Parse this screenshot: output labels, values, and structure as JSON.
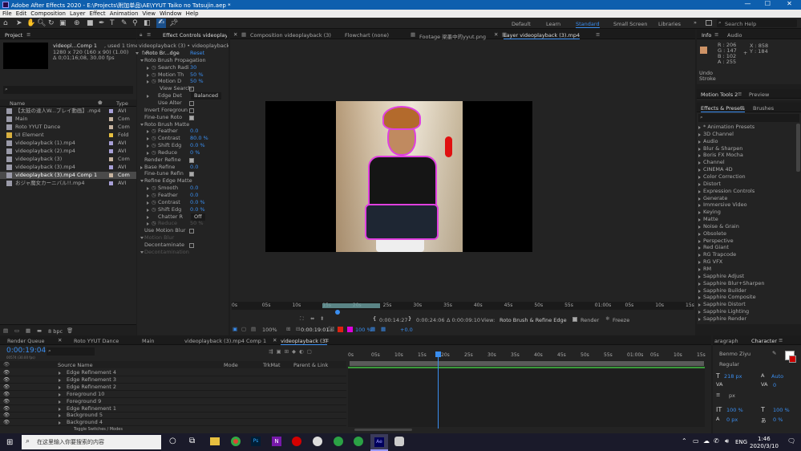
{
  "titlebar": {
    "title": "Adobe After Effects 2020 - E:\\Projects\\附加单品\\AE\\YYUT Taiko no Tatsujin.aep *"
  },
  "menu": [
    "File",
    "Edit",
    "Composition",
    "Layer",
    "Effect",
    "Animation",
    "View",
    "Window",
    "Help"
  ],
  "workspaces": [
    "Default",
    "Learn",
    "Standard",
    "Small Screen",
    "Libraries"
  ],
  "search_help": "Search Help",
  "project": {
    "tab": "Project",
    "item_name": "videopl...Comp 1",
    "used": ", used 1 time",
    "info1": "1280 x 720 (160 x 90) (1.00)",
    "info2": "Δ 0;01;16;08, 30.00 fps",
    "col_name": "Name",
    "col_type": "Type",
    "bpc": "8 bpc",
    "items": [
      {
        "name": "【太鼓の達人W...プレイ動画】.mp4",
        "type": "AVI",
        "color": "#a8a0d8"
      },
      {
        "name": "Main",
        "type": "Com",
        "color": "#c8b4a0"
      },
      {
        "name": "Roto YYUT Dance",
        "type": "Com",
        "color": "#c8b4a0"
      },
      {
        "name": "UI Element",
        "type": "Fold",
        "color": "#e8c040"
      },
      {
        "name": "videoplayback (1).mp4",
        "type": "AVI",
        "color": "#a8a0d8"
      },
      {
        "name": "videoplayback (2).mp4",
        "type": "AVI",
        "color": "#a8a0d8"
      },
      {
        "name": "videoplayback (3)",
        "type": "Com",
        "color": "#c8b4a0"
      },
      {
        "name": "videoplayback (3).mp4",
        "type": "AVI",
        "color": "#a8a0d8"
      },
      {
        "name": "videoplayback (3).mp4 Comp 1",
        "type": "Com",
        "color": "#c8b4a0"
      },
      {
        "name": "おジャ魔女カーニバル!!.mp4",
        "type": "AVI",
        "color": "#a8a0d8"
      }
    ]
  },
  "effect_controls": {
    "tab": "Effect Controls videoplayback",
    "path": "videoplayback (3) • videoplayback (3).mp",
    "rows": [
      {
        "label": "Roto Br...dge",
        "value": "Reset",
        "indent": 0
      },
      {
        "label": "Roto Brush Propagation",
        "value": "",
        "indent": 1
      },
      {
        "label": "Search Radi",
        "value": "30",
        "indent": 2
      },
      {
        "label": "Motion Th",
        "value": "50 %",
        "indent": 2
      },
      {
        "label": "Motion D",
        "value": "50 %",
        "indent": 2
      },
      {
        "label": "View Search",
        "value": "☐",
        "indent": 3
      },
      {
        "label": "Edge Det",
        "value": "Balanced",
        "indent": 2
      },
      {
        "label": "Use Alter",
        "value": "☐",
        "indent": 2
      },
      {
        "label": "Invert Foregroun",
        "value": "☐",
        "indent": 1
      },
      {
        "label": "Fine-tune Roto",
        "value": "☑",
        "indent": 1
      },
      {
        "label": "Roto Brush Matte",
        "value": "",
        "indent": 1
      },
      {
        "label": "Feather",
        "value": "0.0",
        "indent": 2
      },
      {
        "label": "Contrast",
        "value": "80.0 %",
        "indent": 2
      },
      {
        "label": "Shift Edg",
        "value": "0.0 %",
        "indent": 2
      },
      {
        "label": "Reduce",
        "value": "0 %",
        "indent": 2
      },
      {
        "label": "Render Refine",
        "value": "☑",
        "indent": 1
      },
      {
        "label": "Base Refine",
        "value": "0.0",
        "indent": 1
      },
      {
        "label": "Fine-tune Refin",
        "value": "☑",
        "indent": 1
      },
      {
        "label": "Refine Edge Matte",
        "value": "",
        "indent": 1
      },
      {
        "label": "Smooth",
        "value": "0.0",
        "indent": 2
      },
      {
        "label": "Feather",
        "value": "0.0",
        "indent": 2
      },
      {
        "label": "Contrast",
        "value": "0.0 %",
        "indent": 2
      },
      {
        "label": "Shift Edg",
        "value": "0.0 %",
        "indent": 2
      },
      {
        "label": "Chatter R",
        "value": "Off",
        "indent": 2
      },
      {
        "label": "Reduce",
        "value": "50 %",
        "indent": 2
      },
      {
        "label": "Use Motion Blur",
        "value": "☐",
        "indent": 1
      },
      {
        "label": "Motion Blur",
        "value": "",
        "indent": 1
      },
      {
        "label": "Decontaminate",
        "value": "☐",
        "indent": 1
      },
      {
        "label": "Decontamination",
        "value": "",
        "indent": 1
      }
    ]
  },
  "viewer": {
    "tabs": [
      "Composition videoplayback (3)",
      "Flowchart (none)",
      "Footage 梁墨中的yyut.png",
      "Layer videoplayback (3).mp4"
    ],
    "ruler": [
      "0s",
      "05s",
      "10s",
      "15s",
      "20s",
      "25s",
      "30s",
      "35s",
      "40s",
      "45s",
      "50s",
      "55s",
      "01:00s",
      "05s",
      "10s",
      "15s"
    ],
    "zoom": "100%",
    "tc1": "0:00:19:01",
    "tc2": "0:00:14:27",
    "tc3": "0:00:24:06",
    "tc4": "Δ 0:00:09:10",
    "view_label": "View:",
    "view_value": "Roto Brush & Refine Edge",
    "render": "Render",
    "freeze": "Freeze",
    "zoom2": "100 %",
    "offset": "+0.0"
  },
  "info": {
    "tab": "Info",
    "audio": "Audio",
    "r": "R : 206",
    "g": "G : 147",
    "b": "B : 102",
    "a": "A : 255",
    "x": "X : 858",
    "y": "Y : 184",
    "undo": "Undo",
    "stroke": "Stroke",
    "swatch": "#ce9366"
  },
  "motion_tools": {
    "tab": "Motion Tools 2",
    "preview": "Preview"
  },
  "effects_presets": {
    "tab": "Effects & Presets",
    "brushes": "Brushes",
    "items": [
      "* Animation Presets",
      "3D Channel",
      "Audio",
      "Blur & Sharpen",
      "Boris FX Mocha",
      "Channel",
      "CINEMA 4D",
      "Color Correction",
      "Distort",
      "Expression Controls",
      "Generate",
      "Immersive Video",
      "Keying",
      "Matte",
      "Noise & Grain",
      "Obsolete",
      "Perspective",
      "Red Giant",
      "RG Trapcode",
      "RG VFX",
      "RM",
      "Sapphire Adjust",
      "Sapphire Blur+Sharpen",
      "Sapphire Builder",
      "Sapphire Composite",
      "Sapphire Distort",
      "Sapphire Lighting",
      "Sapphire Render"
    ]
  },
  "timeline": {
    "tabs": [
      "Render Queue",
      "Roto YYUT Dance",
      "Main",
      "videoplayback (3).mp4 Comp 1",
      "videoplayback (3)"
    ],
    "timecode": "0:00:19:04",
    "fps": "00574 (30.00 fps)",
    "col_source": "Source Name",
    "col_mode": "Mode",
    "col_trk": "TrkMat",
    "col_parent": "Parent & Link",
    "layers": [
      "Edge Refinement 4",
      "Edge Refinement 3",
      "Edge Refinement 2",
      "Foreground 10",
      "Foreground 9",
      "Edge Refinement 1",
      "Background 5",
      "Background 4"
    ],
    "ruler": [
      "0s",
      "05s",
      "10s",
      "15s",
      "20s",
      "25s",
      "30s",
      "35s",
      "40s",
      "45s",
      "50s",
      "55s",
      "01:00s",
      "05s",
      "10s",
      "15s"
    ],
    "toggle": "Toggle Switches / Modes"
  },
  "character": {
    "tab": "Character",
    "paragraph": "aragraph",
    "font": "Benmo Ziyu",
    "style": "Regular",
    "size": "218 px",
    "leading": "Auto",
    "kern": "0",
    "unit": "px",
    "vscale": "100 %",
    "hscale": "100 %",
    "baseline": "0 px",
    "tsume": "0 %"
  },
  "taskbar": {
    "search": "在这里输入你要搜索的内容",
    "ime": "ENG",
    "time": "1:46",
    "date": "2020/3/10"
  }
}
